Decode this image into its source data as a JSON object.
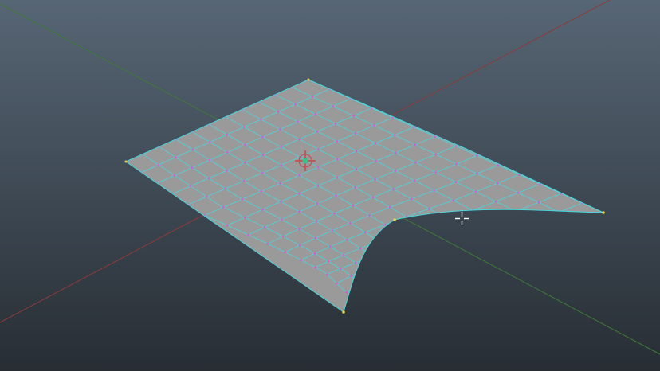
{
  "viewport": {
    "view_name": "perspective-viewport",
    "background_top": "#576675",
    "background_bottom": "#272d33"
  },
  "scene": {
    "axes": {
      "x_axis_color": "#8c3a3a",
      "z_axis_color": "#3e7a3a"
    },
    "surface": {
      "fill_color": "#9a9a9a",
      "edge_color": "#4ad6dc",
      "vertex_color": "#d957d9",
      "corner_vertex_color": "#e8d44a",
      "grid_columns": 14,
      "grid_rows": 11
    },
    "manipulator": {
      "icon": "pivot-manipulator-icon",
      "center_color": "#3cc08a",
      "arm_color": "#c84848"
    }
  },
  "cursor": {
    "icon": "crosshair-cursor-icon",
    "color": "#ffffff"
  }
}
